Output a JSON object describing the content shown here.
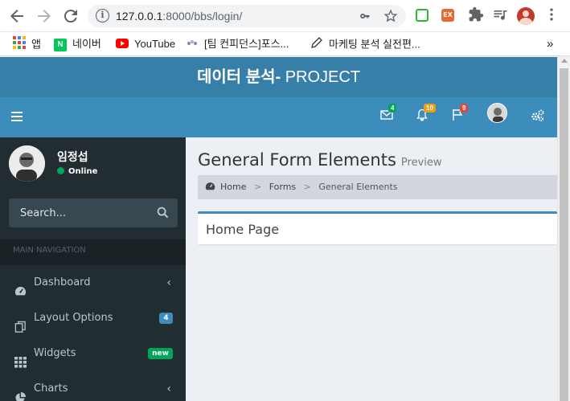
{
  "browser": {
    "url_host": "127.0.0.1",
    "url_rest": ":8000/bbs/login/",
    "icons": [
      "back-icon",
      "forward-icon",
      "reload-icon",
      "site-info-icon",
      "key-icon",
      "star-icon",
      "extension-screen-icon",
      "extension-ex-icon",
      "puzzle-icon",
      "media-icon",
      "profile-avatar",
      "menu-dots-icon"
    ],
    "ext_ex_label": "EX",
    "bookmarks": [
      {
        "label": "앱",
        "icon": "apps-grid-icon"
      },
      {
        "label": "네이버",
        "icon": "naver-icon",
        "icon_text": "N"
      },
      {
        "label": "YouTube",
        "icon": "youtube-icon"
      },
      {
        "label": "[팀 컨피던스]포스...",
        "icon": "team-icon"
      },
      {
        "label": "마케팅 분석 실전편...",
        "icon": "pen-icon"
      }
    ],
    "more": "»"
  },
  "app": {
    "title_bold": "데이터 분석-",
    "title_rest": " PROJECT",
    "colors": {
      "header_dark": "#367fa9",
      "header": "#3c8dbc",
      "sidebar": "#222d32"
    }
  },
  "navbar": {
    "mail_count": "4",
    "notif_count": "10",
    "flag_count": "9"
  },
  "sidebar": {
    "user_name": "임정섭",
    "status": "Online",
    "search_placeholder": "Search...",
    "nav_header": "MAIN NAVIGATION",
    "items": [
      {
        "label": "Dashboard",
        "icon": "dashboard-icon"
      },
      {
        "label": "Layout Options",
        "icon": "files-icon",
        "badge": "4"
      },
      {
        "label": "Widgets",
        "icon": "th-icon",
        "badge": "new"
      },
      {
        "label": "Charts",
        "icon": "pie-chart-icon"
      }
    ]
  },
  "content": {
    "title": "General Form Elements",
    "subtitle": "Preview",
    "breadcrumb": [
      "Home",
      "Forms",
      "General Elements"
    ],
    "breadcrumb_sep": ">",
    "box_title": "Home Page"
  }
}
